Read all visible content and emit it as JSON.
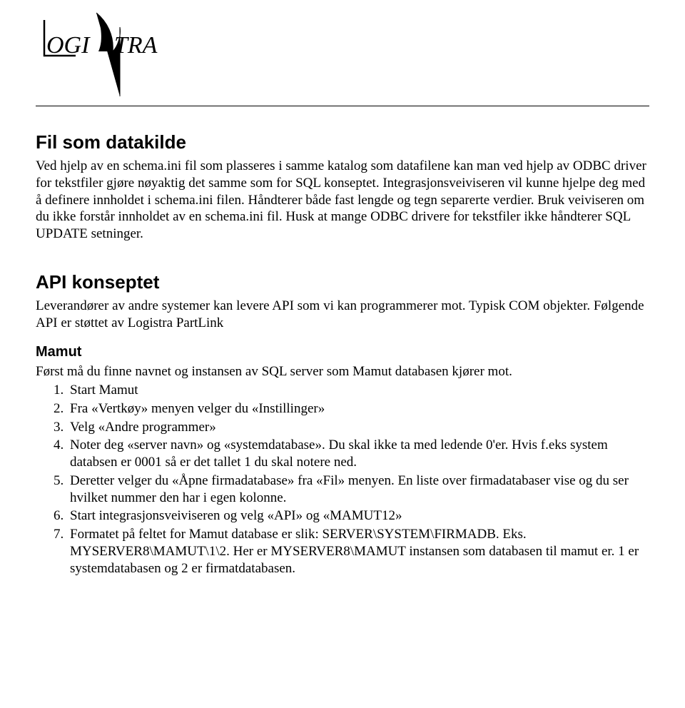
{
  "sections": {
    "fil": {
      "heading": "Fil som datakilde",
      "body": "Ved hjelp av en schema.ini fil som plasseres i samme katalog som datafilene kan man ved hjelp av ODBC driver for tekstfiler gjøre nøyaktig det samme som for SQL konseptet. Integrasjonsveiviseren vil kunne hjelpe deg med å definere innholdet i schema.ini filen. Håndterer både fast lengde og tegn separerte verdier. Bruk veiviseren om du ikke forstår innholdet av en schema.ini fil. Husk at mange ODBC drivere for tekstfiler ikke håndterer SQL UPDATE setninger."
    },
    "api": {
      "heading": "API konseptet",
      "body": "Leverandører av andre systemer kan levere API som vi kan programmerer mot. Typisk COM objekter. Følgende API er støttet av Logistra PartLink"
    },
    "mamut": {
      "heading": "Mamut",
      "intro": "Først må du finne navnet og instansen av SQL server som Mamut databasen kjører mot.",
      "steps": [
        "Start Mamut",
        "Fra «Vertkøy» menyen velger du «Instillinger»",
        "Velg «Andre programmer»",
        "Noter deg «server navn» og «systemdatabase». Du skal ikke ta med ledende 0'er. Hvis f.eks system databsen er 0001 så er det tallet 1 du skal notere ned.",
        "Deretter velger du «Åpne firmadatabase» fra «Fil» menyen. En liste over firmadatabaser vise og du ser hvilket nummer den har i egen kolonne.",
        "Start integrasjonsveiviseren og velg «API» og «MAMUT12»",
        "Formatet på feltet for Mamut database er slik:  SERVER\\SYSTEM\\FIRMADB. Eks. MYSERVER8\\MAMUT\\1\\2. Her er MYSERVER8\\MAMUT instansen som databasen til mamut er. 1 er systemdatabasen og 2 er firmatdatabasen."
      ]
    }
  }
}
